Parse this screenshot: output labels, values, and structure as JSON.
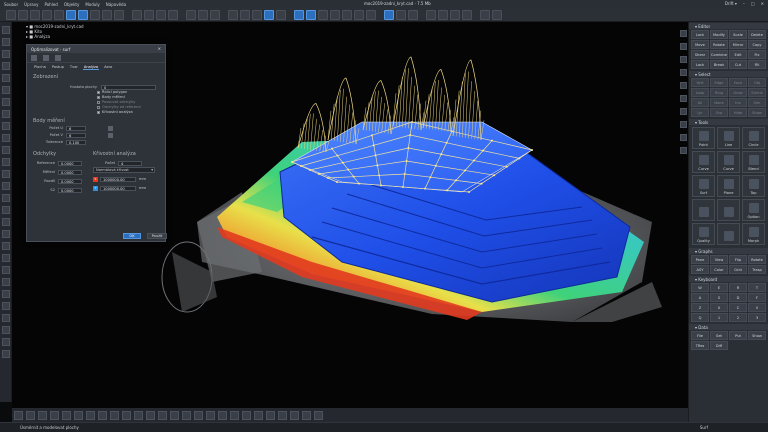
{
  "window": {
    "file_title": "moc2019-zadni_kryt.cad · 7.5 Mb",
    "controls": [
      "–",
      "□",
      "✕"
    ]
  },
  "menubar": {
    "items": [
      "Soubor",
      "Úpravy",
      "Pohled",
      "Objekty",
      "Moduly",
      "Nápověda"
    ],
    "right_label": "Drift ▾"
  },
  "toolbar": {
    "groups": [
      10,
      4,
      3,
      5,
      7,
      3,
      4,
      2
    ],
    "active_indices": [
      5,
      6,
      20,
      22,
      23,
      29
    ]
  },
  "scene_tree": {
    "items": [
      "▾ ■ moc2019-zadni_kryt.cad",
      "   ▸ ■ Kito",
      "   ▸ ■ Analýza"
    ]
  },
  "dialog": {
    "title": "Optimalizovat · surf",
    "close": "×",
    "tabs": [
      "Plocha",
      "Postup",
      "Tvar",
      "Analýza",
      "Aero"
    ],
    "active_tab": "Analýza",
    "section_display": "Zobrazení",
    "points_label": "Hustota plochy",
    "points_value": "0",
    "checks": [
      {
        "label": "Řídicí polygon",
        "on": true,
        "dim": false
      },
      {
        "label": "Body měření",
        "on": true,
        "dim": false
      },
      {
        "label": "Posouvat odchylky",
        "on": false,
        "dim": true
      },
      {
        "label": "Odchylky od referencí",
        "on": false,
        "dim": true
      },
      {
        "label": "Křivostní analýza",
        "on": true,
        "dim": false
      }
    ],
    "section_points": "Body měření",
    "count_u_label": "Počet U",
    "count_u_value": "6",
    "count_v_label": "Počet V",
    "count_v_value": "6",
    "tol_label": "Tolerance",
    "tol_value": "0.100",
    "section_dev": "Odchylky",
    "dev_rows": [
      {
        "label": "Reference",
        "value": "0.0000"
      },
      {
        "label": "Měření",
        "value": "0.0000"
      },
      {
        "label": "Rozdíl",
        "value": "0.0000"
      },
      {
        "label": "S2",
        "value": "0.0000"
      }
    ],
    "section_curv": "Křivostní analýza",
    "curv_count_label": "Počet",
    "curv_count_value": "4",
    "curv_type": "Normálová křivost",
    "curv_rows": [
      {
        "tag": "S",
        "value": "1000000.00",
        "unit": "mm"
      },
      {
        "tag": "T",
        "value": "1000000.00",
        "unit": "mm"
      }
    ],
    "ok_label": "OK",
    "apply_label": "Použít"
  },
  "right_panel": {
    "sections": [
      {
        "title": "▾ Editor",
        "cells": [
          "Lock",
          "Modify",
          "Scale",
          "Delete",
          "Move",
          "Rotate",
          "Mirror",
          "Copy",
          "Shear",
          "Combine",
          "Edit",
          "Fix",
          "Lock",
          "Break",
          "Cut",
          "Fill"
        ],
        "dim": false
      },
      {
        "title": "▾ Select",
        "cells": [
          "Vert",
          "Edge",
          "Face",
          "Obj",
          "Loop",
          "Ring",
          "Grow",
          "Shrink",
          "All",
          "None",
          "Inv",
          "Sim",
          "Lyr",
          "Grp",
          "Hide",
          "Show"
        ],
        "dim": true
      },
      {
        "title": "▾ Tools",
        "big": [
          "Point",
          "Line",
          "Circle",
          "Curve",
          "Curve",
          "Blend",
          "Surf",
          "Plane",
          "Tap",
          "",
          "",
          "Option",
          "Quality",
          "",
          "Morph"
        ]
      },
      {
        "title": "▾ Graphs",
        "cells": [
          "Pane",
          "View",
          "Flip",
          "Rotate",
          "ASY",
          "Color",
          "Grid",
          "Trasp"
        ],
        "dim": false
      },
      {
        "title": "▾ Keyboard",
        "cells": [
          "W",
          "E",
          "R",
          "T",
          "A",
          "S",
          "D",
          "F",
          "Z",
          "X",
          "C",
          "V",
          "Q",
          "1",
          "2",
          "3"
        ],
        "dim": false
      },
      {
        "title": "▾ Data",
        "cells": [
          "File",
          "Set",
          "Put",
          "Show",
          "TRes",
          "Diff"
        ],
        "dim": false
      }
    ]
  },
  "statusbar": {
    "message": "Úsměrnit a modelovat plochy",
    "right": "Surf"
  },
  "colors": {
    "accent": "#2d6fbf",
    "surface_blue": "#1f4fe8",
    "heat_red": "#e23a1f",
    "heat_green": "#3fd27a",
    "scan_gray": "#8a8d90",
    "net_yellow": "#e8d27a"
  },
  "curvature_combs": [
    0.55,
    0.8,
    0.62,
    0.9,
    0.75,
    1.0
  ]
}
